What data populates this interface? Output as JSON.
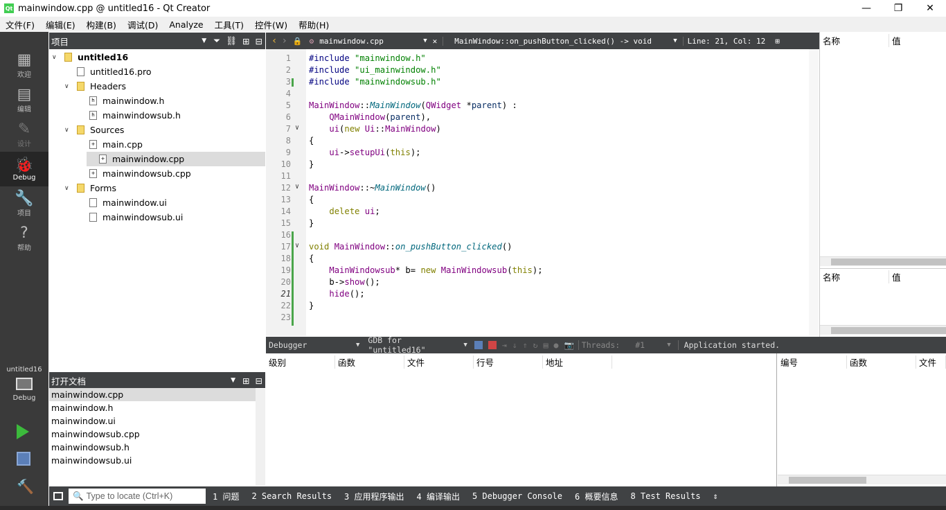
{
  "window": {
    "title": "mainwindow.cpp @ untitled16 - Qt Creator",
    "minimize": "—",
    "maximize": "❐",
    "close": "✕"
  },
  "menu": [
    "文件(F)",
    "编辑(E)",
    "构建(B)",
    "调试(D)",
    "Analyze",
    "工具(T)",
    "控件(W)",
    "帮助(H)"
  ],
  "modes": [
    {
      "label": "欢迎",
      "icon": "grid-icon"
    },
    {
      "label": "编辑",
      "icon": "document-icon"
    },
    {
      "label": "设计",
      "icon": "pencil-icon"
    },
    {
      "label": "Debug",
      "icon": "bug-icon"
    },
    {
      "label": "项目",
      "icon": "wrench-icon"
    },
    {
      "label": "帮助",
      "icon": "help-icon"
    }
  ],
  "kit": {
    "project": "untitled16",
    "mode": "Debug"
  },
  "project_panel": {
    "title": "项目",
    "tree": [
      {
        "label": "untitled16",
        "level": 0,
        "expanded": true,
        "bold": true,
        "kind": "project"
      },
      {
        "label": "untitled16.pro",
        "level": 1,
        "kind": "pro"
      },
      {
        "label": "Headers",
        "level": 1,
        "expanded": true,
        "kind": "folder"
      },
      {
        "label": "mainwindow.h",
        "level": 2,
        "kind": "h"
      },
      {
        "label": "mainwindowsub.h",
        "level": 2,
        "kind": "h"
      },
      {
        "label": "Sources",
        "level": 1,
        "expanded": true,
        "kind": "folder"
      },
      {
        "label": "main.cpp",
        "level": 2,
        "kind": "cpp"
      },
      {
        "label": "mainwindow.cpp",
        "level": 2,
        "kind": "cpp",
        "selected": true
      },
      {
        "label": "mainwindowsub.cpp",
        "level": 2,
        "kind": "cpp"
      },
      {
        "label": "Forms",
        "level": 1,
        "expanded": true,
        "kind": "folder"
      },
      {
        "label": "mainwindow.ui",
        "level": 2,
        "kind": "ui"
      },
      {
        "label": "mainwindowsub.ui",
        "level": 2,
        "kind": "ui"
      }
    ]
  },
  "open_documents": {
    "title": "打开文档",
    "items": [
      "mainwindow.cpp",
      "mainwindow.h",
      "mainwindow.ui",
      "mainwindowsub.cpp",
      "mainwindowsub.h",
      "mainwindowsub.ui"
    ],
    "selected": 0
  },
  "editor_toolbar": {
    "file": "mainwindow.cpp",
    "symbol": "MainWindow::on_pushButton_clicked() -> void",
    "position": "Line: 21, Col: 12"
  },
  "code_lines": [
    [
      [
        "mac",
        "#include "
      ],
      [
        "str",
        "\"mainwindow.h\""
      ]
    ],
    [
      [
        "mac",
        "#include "
      ],
      [
        "str",
        "\"ui_mainwindow.h\""
      ]
    ],
    [
      [
        "mac",
        "#include "
      ],
      [
        "str",
        "\"mainwindowsub.h\""
      ]
    ],
    [],
    [
      [
        "ty",
        "MainWindow"
      ],
      [
        "",
        "::"
      ],
      [
        "fn",
        "MainWindow"
      ],
      [
        "",
        "("
      ],
      [
        "ty",
        "QWidget"
      ],
      [
        "",
        " *"
      ],
      [
        "par",
        "parent"
      ],
      [
        "",
        ") :"
      ]
    ],
    [
      [
        "",
        "    "
      ],
      [
        "ty",
        "QMainWindow"
      ],
      [
        "",
        "("
      ],
      [
        "par",
        "parent"
      ],
      [
        "",
        "),"
      ]
    ],
    [
      [
        "",
        "    "
      ],
      [
        "ty",
        "ui"
      ],
      [
        "",
        "("
      ],
      [
        "kw",
        "new "
      ],
      [
        "ty",
        "Ui"
      ],
      [
        "",
        "::"
      ],
      [
        "ty",
        "MainWindow"
      ],
      [
        "",
        ")"
      ]
    ],
    [
      [
        "",
        "{"
      ]
    ],
    [
      [
        "",
        "    "
      ],
      [
        "ty",
        "ui"
      ],
      [
        "",
        "->"
      ],
      [
        "ty",
        "setupUi"
      ],
      [
        "",
        "("
      ],
      [
        "kw",
        "this"
      ],
      [
        "",
        ");"
      ]
    ],
    [
      [
        "",
        "}"
      ]
    ],
    [],
    [
      [
        "ty",
        "MainWindow"
      ],
      [
        "",
        "::~"
      ],
      [
        "fn",
        "MainWindow"
      ],
      [
        "",
        "()"
      ]
    ],
    [
      [
        "",
        "{"
      ]
    ],
    [
      [
        "",
        "    "
      ],
      [
        "kw",
        "delete "
      ],
      [
        "ty",
        "ui"
      ],
      [
        "",
        ";"
      ]
    ],
    [
      [
        "",
        "}"
      ]
    ],
    [],
    [
      [
        "kw",
        "void "
      ],
      [
        "ty",
        "MainWindow"
      ],
      [
        "",
        "::"
      ],
      [
        "fn",
        "on_pushButton_clicked"
      ],
      [
        "",
        "()"
      ]
    ],
    [
      [
        "",
        "{"
      ]
    ],
    [
      [
        "",
        "    "
      ],
      [
        "ty",
        "MainWindowsub"
      ],
      [
        "",
        "* b= "
      ],
      [
        "kw",
        "new "
      ],
      [
        "ty",
        "MainWindowsub"
      ],
      [
        "",
        "("
      ],
      [
        "kw",
        "this"
      ],
      [
        "",
        ");"
      ]
    ],
    [
      [
        "",
        "    b->"
      ],
      [
        "ty",
        "show"
      ],
      [
        "",
        "();"
      ]
    ],
    [
      [
        "",
        "    "
      ],
      [
        "ty",
        "hide"
      ],
      [
        "",
        "();"
      ]
    ],
    [
      [
        "",
        "}"
      ]
    ],
    []
  ],
  "folds": [
    7,
    12,
    17
  ],
  "locals_panel": {
    "col_name": "名称",
    "col_value": "值"
  },
  "watch_panel": {
    "col_name": "名称",
    "col_value": "值"
  },
  "debugger_bar": {
    "engine": "Debugger",
    "target": "GDB for \"untitled16\"",
    "threads_label": "Threads:",
    "thread_value": "#1",
    "status": "Application started."
  },
  "stack_columns": [
    "级别",
    "函数",
    "文件",
    "行号",
    "地址"
  ],
  "breakpoint_columns": [
    "编号",
    "函数",
    "文件"
  ],
  "statusbar": {
    "locate_placeholder": "Type to locate (Ctrl+K)",
    "panes": [
      "1  问题",
      "2  Search Results",
      "3  应用程序输出",
      "4  编译输出",
      "5  Debugger Console",
      "6  概要信息",
      "8  Test Results"
    ]
  },
  "colors": {
    "accent": "#41cd52",
    "dark": "#404244",
    "sidebar": "#3a3a3a"
  }
}
